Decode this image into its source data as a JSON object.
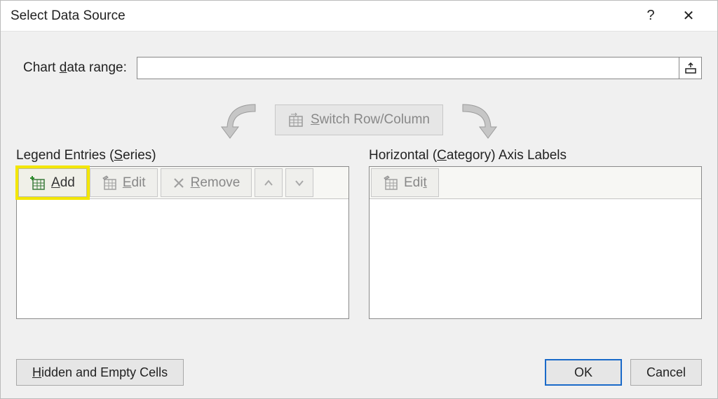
{
  "titlebar": {
    "title": "Select Data Source",
    "help": "?",
    "close": "✕"
  },
  "range": {
    "label_prefix": "Chart ",
    "label_underline": "d",
    "label_suffix": "ata range:",
    "value": ""
  },
  "switch": {
    "label_underline": "S",
    "label_rest": "witch Row/Column"
  },
  "legend": {
    "label_prefix": "Legend Entries (",
    "label_underline": "S",
    "label_suffix": "eries)",
    "add_underline": "A",
    "add_rest": "dd",
    "edit_underline": "E",
    "edit_rest": "dit",
    "remove_underline": "R",
    "remove_rest": "emove"
  },
  "category": {
    "label_prefix": "Horizontal (",
    "label_underline": "C",
    "label_suffix": "ategory) Axis Labels",
    "edit_prefix": "Edi",
    "edit_underline": "t"
  },
  "footer": {
    "hidden_underline": "H",
    "hidden_rest": "idden and Empty Cells",
    "ok": "OK",
    "cancel": "Cancel"
  }
}
